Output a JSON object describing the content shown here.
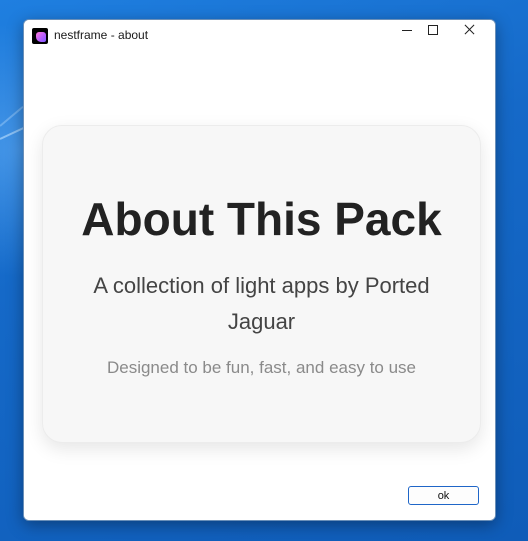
{
  "window": {
    "title": "nestframe - about",
    "app_icon": "nestframe-app-icon"
  },
  "titlebar_controls": {
    "minimize_icon": "minimize-icon",
    "maximize_icon": "maximize-icon",
    "close_icon": "close-icon"
  },
  "card": {
    "title": "About This Pack",
    "subtitle": "A collection of light apps by Ported Jaguar",
    "note": "Designed to be fun, fast, and easy to use"
  },
  "footer": {
    "ok_label": "ok"
  },
  "colors": {
    "desktop": "#1569c8",
    "card_background": "#f7f7f7",
    "title_text": "#222222",
    "note_text": "#8a8a8a",
    "ok_border": "#1f66c8"
  }
}
